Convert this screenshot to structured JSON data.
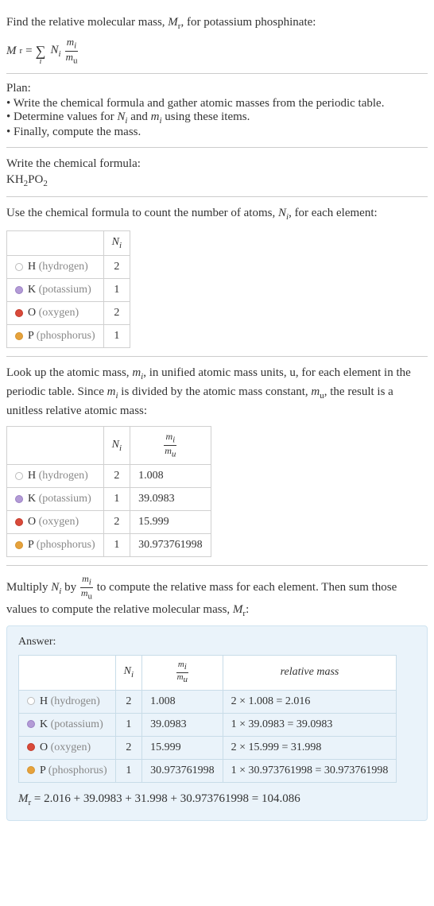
{
  "intro": {
    "text": "Find the relative molecular mass, Mr, for potassium phosphinate:",
    "formula_lhs": "M",
    "formula_r": "r",
    "eq": " = ",
    "sigma": "∑",
    "sigma_sub": "i",
    "Ni": "N",
    "Ni_sub": "i",
    "frac_num": "mᵢ",
    "frac_den": "m",
    "frac_den_sub": "u"
  },
  "plan": {
    "title": "Plan:",
    "items": [
      "Write the chemical formula and gather atomic masses from the periodic table.",
      "Determine values for Nᵢ and mᵢ using these items.",
      "Finally, compute the mass."
    ]
  },
  "chem": {
    "title": "Write the chemical formula:",
    "formula": "KH₂PO₂"
  },
  "count_text": "Use the chemical formula to count the number of atoms, Nᵢ, for each element:",
  "table1": {
    "header_ni": "Nᵢ",
    "rows": [
      {
        "sym": "H",
        "name": "(hydrogen)",
        "dot": "h",
        "ni": "2"
      },
      {
        "sym": "K",
        "name": "(potassium)",
        "dot": "k",
        "ni": "1"
      },
      {
        "sym": "O",
        "name": "(oxygen)",
        "dot": "o",
        "ni": "2"
      },
      {
        "sym": "P",
        "name": "(phosphorus)",
        "dot": "p",
        "ni": "1"
      }
    ]
  },
  "lookup_text": "Look up the atomic mass, mᵢ, in unified atomic mass units, u, for each element in the periodic table. Since mᵢ is divided by the atomic mass constant, mᵤ, the result is a unitless relative atomic mass:",
  "table2": {
    "header_ni": "Nᵢ",
    "header_frac_num": "mᵢ",
    "header_frac_den": "mᵤ",
    "rows": [
      {
        "sym": "H",
        "name": "(hydrogen)",
        "dot": "h",
        "ni": "2",
        "mass": "1.008"
      },
      {
        "sym": "K",
        "name": "(potassium)",
        "dot": "k",
        "ni": "1",
        "mass": "39.0983"
      },
      {
        "sym": "O",
        "name": "(oxygen)",
        "dot": "o",
        "ni": "2",
        "mass": "15.999"
      },
      {
        "sym": "P",
        "name": "(phosphorus)",
        "dot": "p",
        "ni": "1",
        "mass": "30.973761998"
      }
    ]
  },
  "multiply_text_1": "Multiply Nᵢ by ",
  "multiply_text_2": " to compute the relative mass for each element. Then sum those values to compute the relative molecular mass, Mr:",
  "answer": {
    "label": "Answer:",
    "header_ni": "Nᵢ",
    "header_frac_num": "mᵢ",
    "header_frac_den": "mᵤ",
    "header_rel": "relative mass",
    "rows": [
      {
        "sym": "H",
        "name": "(hydrogen)",
        "dot": "h",
        "ni": "2",
        "mass": "1.008",
        "rel": "2 × 1.008 = 2.016"
      },
      {
        "sym": "K",
        "name": "(potassium)",
        "dot": "k",
        "ni": "1",
        "mass": "39.0983",
        "rel": "1 × 39.0983 = 39.0983"
      },
      {
        "sym": "O",
        "name": "(oxygen)",
        "dot": "o",
        "ni": "2",
        "mass": "15.999",
        "rel": "2 × 15.999 = 31.998"
      },
      {
        "sym": "P",
        "name": "(phosphorus)",
        "dot": "p",
        "ni": "1",
        "mass": "30.973761998",
        "rel": "1 × 30.973761998 = 30.973761998"
      }
    ],
    "final": "Mr = 2.016 + 39.0983 + 31.998 + 30.973761998 = 104.086"
  }
}
